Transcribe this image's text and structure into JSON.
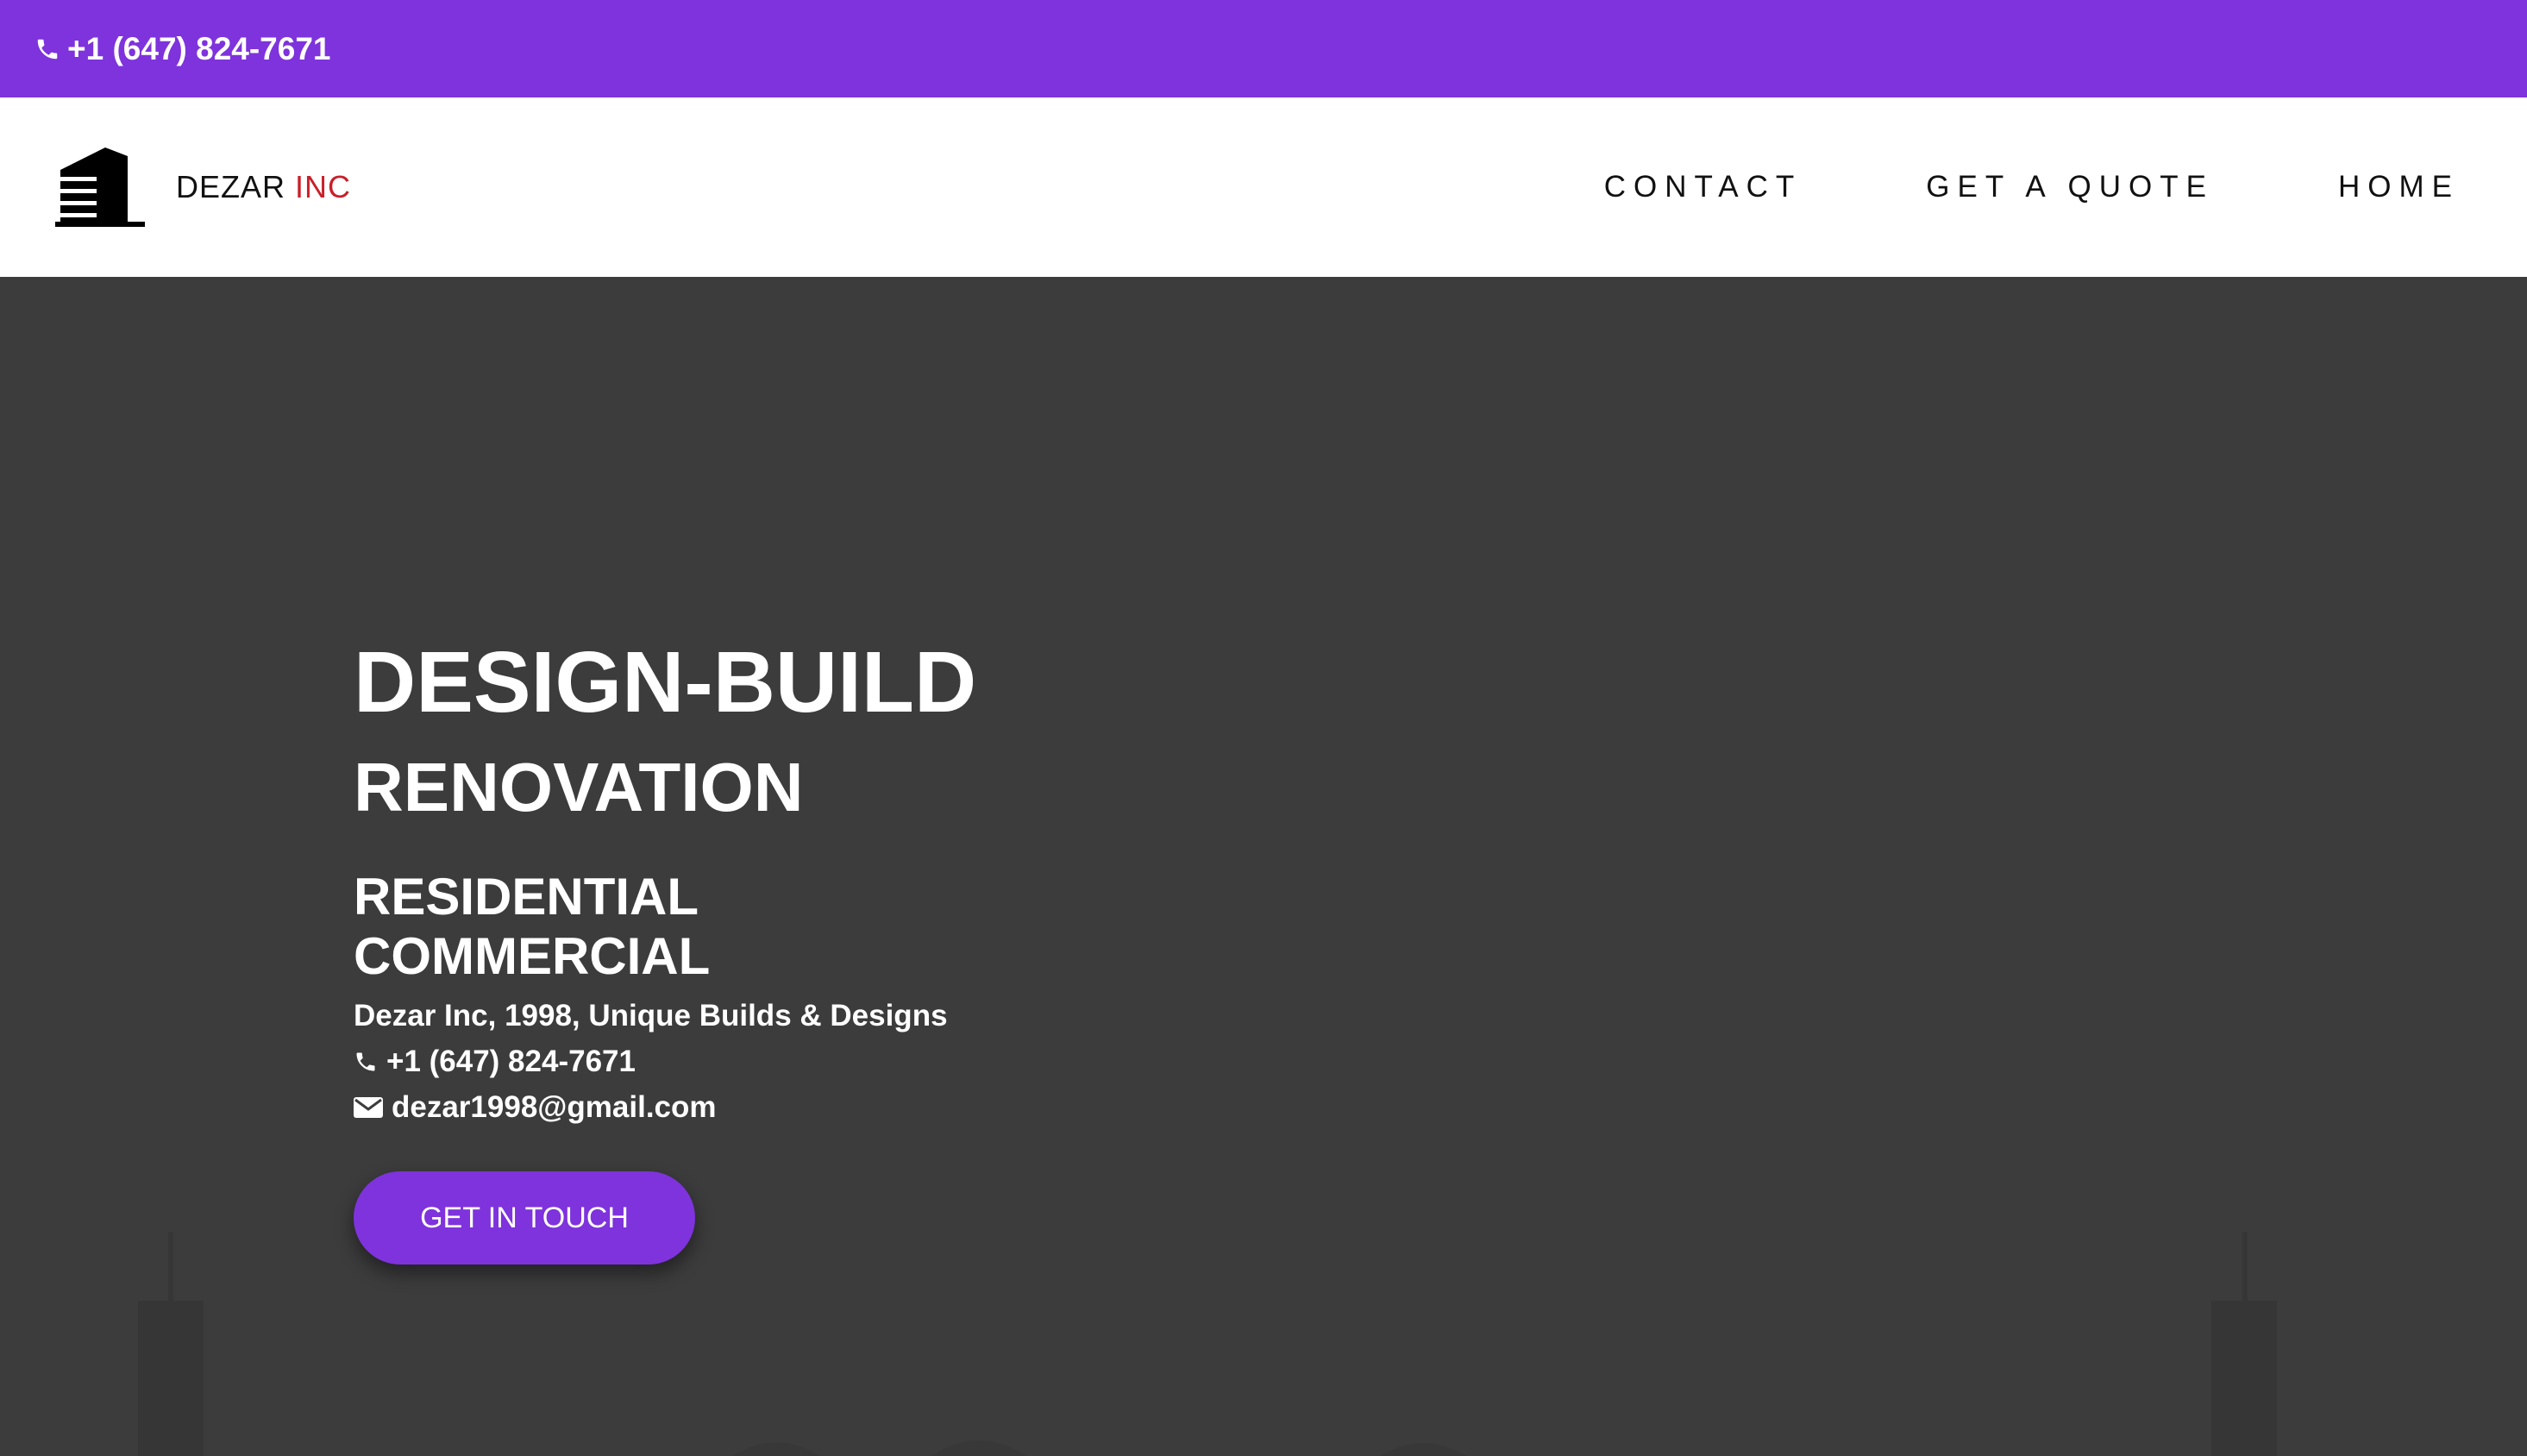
{
  "colors": {
    "accent": "#7e33dc",
    "hero_bg": "#3c3c3c",
    "logo_inc": "#c8202a"
  },
  "topbar": {
    "phone": "+1 (647) 824-7671",
    "icon": "phone-icon"
  },
  "logo": {
    "name": "DEZAR",
    "suffix": "INC",
    "icon": "building-icon"
  },
  "nav": {
    "items": [
      {
        "label": "CONTACT"
      },
      {
        "label": "GET A QUOTE"
      },
      {
        "label": "HOME"
      }
    ]
  },
  "hero": {
    "title": "DESIGN-BUILD",
    "subtitle": "RENOVATION",
    "line1": "RESIDENTIAL",
    "line2": "COMMERCIAL",
    "tagline": "Dezar Inc, 1998, Unique Builds & Designs",
    "phone": "+1 (647) 824-7671",
    "email": "dezar1998@gmail.com",
    "cta_label": "GET IN TOUCH"
  }
}
